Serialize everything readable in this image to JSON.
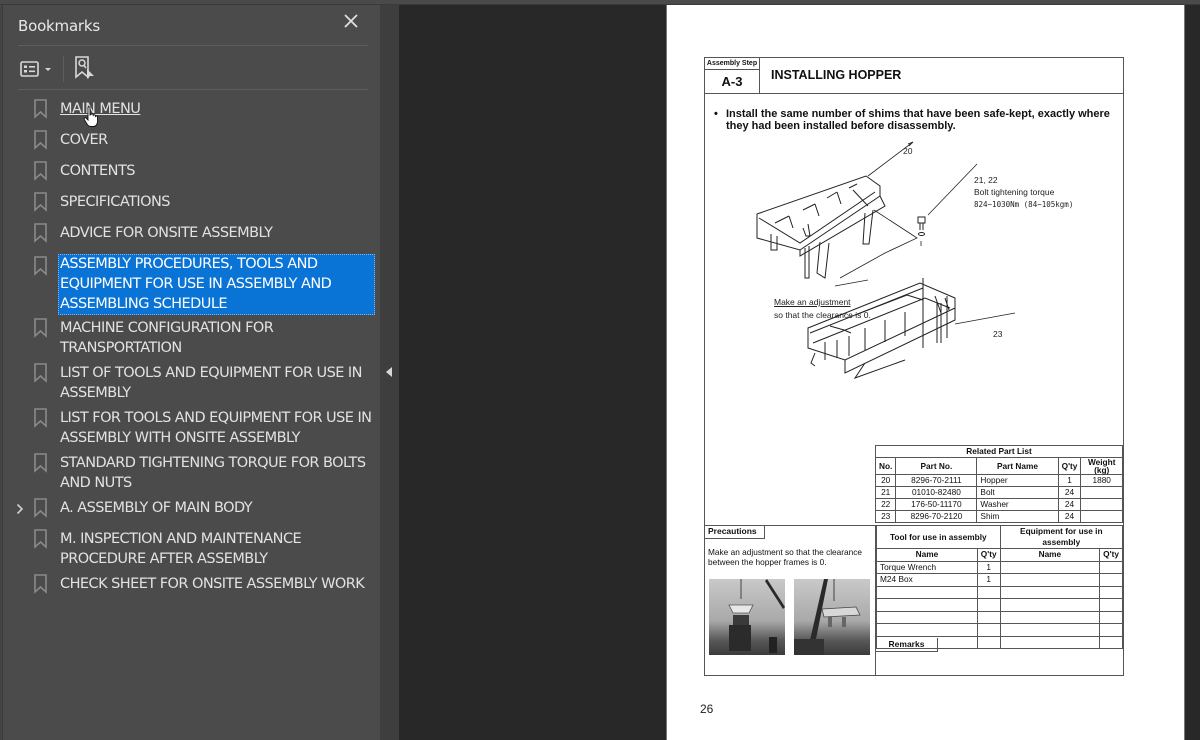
{
  "sidebar": {
    "title": "Bookmarks",
    "close_icon": "close-icon",
    "toolbar": {
      "options_icon": "list-options-icon",
      "find_icon": "find-current-bookmark-icon"
    },
    "items": [
      {
        "label": "MAIN MENU",
        "hovered": true,
        "expandable": false
      },
      {
        "label": "COVER",
        "expandable": false
      },
      {
        "label": "CONTENTS",
        "expandable": false
      },
      {
        "label": "SPECIFICATIONS",
        "expandable": false
      },
      {
        "label": "ADVICE FOR ONSITE ASSEMBLY",
        "expandable": false
      },
      {
        "label": "ASSEMBLY PROCEDURES, TOOLS AND EQUIPMENT FOR USE IN ASSEMBLY AND ASSEMBLING SCHEDULE",
        "selected": true,
        "expandable": false
      },
      {
        "label": "MACHINE CONFIGURATION FOR TRANSPORTATION",
        "expandable": false
      },
      {
        "label": "LIST OF TOOLS AND EQUIPMENT FOR USE IN ASSEMBLY",
        "expandable": false
      },
      {
        "label": "LIST FOR TOOLS AND EQUIPMENT FOR USE IN ASSEMBLY WITH ONSITE ASSEMBLY",
        "expandable": false
      },
      {
        "label": "STANDARD TIGHTENING TORQUE FOR BOLTS AND NUTS",
        "expandable": false
      },
      {
        "label": "A. ASSEMBLY OF MAIN BODY",
        "expandable": true,
        "expander_icon": "chevron-right-icon"
      },
      {
        "label": "M. INSPECTION AND MAINTENANCE PROCEDURE AFTER ASSEMBLY",
        "expandable": false
      },
      {
        "label": "CHECK SHEET FOR ONSITE ASSEMBLY WORK",
        "expandable": false
      }
    ]
  },
  "colors": {
    "selection": "#0a74d6",
    "sidebar_bg": "#4b4b4b",
    "viewer_bg": "#282828"
  },
  "document": {
    "assembly_step_label": "Assembly Step",
    "assembly_step": "A-3",
    "title": "INSTALLING HOPPER",
    "instruction_bullet": "•",
    "instruction": "Install the same number of shims that have been safe-kept, exactly where they had been installed before disassembly.",
    "callouts": {
      "c20": "20",
      "c21_22": "21, 22",
      "bolt_torque_label": "Bolt tightening torque",
      "bolt_torque_value": "824~1030Nm (84~105kgm)",
      "adjust_line1": "Make an adjustment",
      "adjust_line2": "so that the clearance is 0.",
      "c23": "23"
    },
    "related_parts": {
      "title": "Related Part List",
      "headers": [
        "No.",
        "Part No.",
        "Part Name",
        "Q'ty",
        "Weight (kg)"
      ],
      "rows": [
        [
          "20",
          "8296-70-2111",
          "Hopper",
          "1",
          "1880"
        ],
        [
          "21",
          "01010-82480",
          "Bolt",
          "24",
          ""
        ],
        [
          "22",
          "176-50-11170",
          "Washer",
          "24",
          ""
        ],
        [
          "23",
          "8296-70-2120",
          "Shim",
          "24",
          ""
        ]
      ]
    },
    "precautions": {
      "label": "Precautions",
      "text": "Make an adjustment so that the clearance between the hopper frames is 0.",
      "photos": [
        "hopper-lifting-photo-1",
        "hopper-lifting-photo-2"
      ]
    },
    "tools": {
      "tool_title": "Tool for use in assembly",
      "equip_title": "Equipment for use in assembly",
      "headers": [
        "Name",
        "Q'ty",
        "Name",
        "Q'ty"
      ],
      "rows": [
        [
          "Torque Wrench",
          "1",
          "",
          ""
        ],
        [
          "M24 Box",
          "1",
          "",
          ""
        ],
        [
          "",
          "",
          "",
          ""
        ],
        [
          "",
          "",
          "",
          ""
        ],
        [
          "",
          "",
          "",
          ""
        ],
        [
          "",
          "",
          "",
          ""
        ],
        [
          "",
          "",
          "",
          ""
        ]
      ]
    },
    "remarks_label": "Remarks",
    "page_number": "26"
  }
}
